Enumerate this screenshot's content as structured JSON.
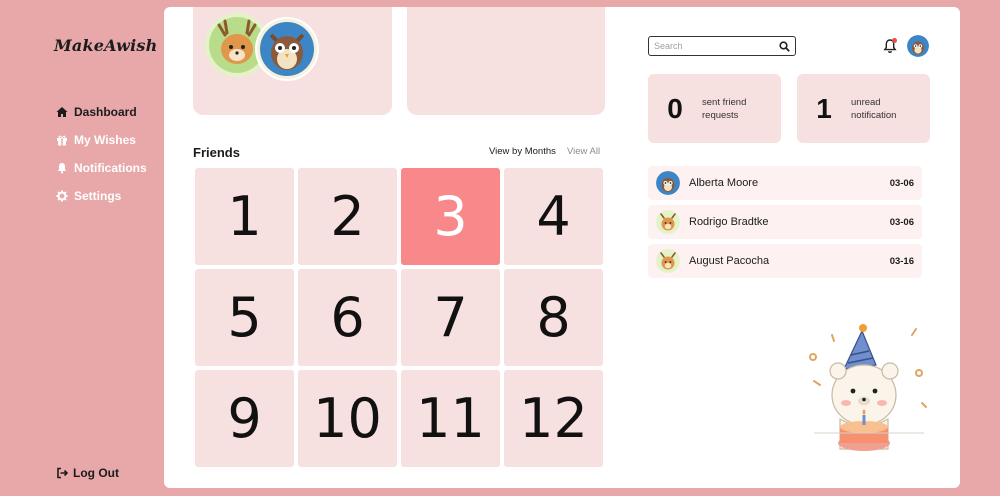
{
  "app": {
    "logo": "MakeAwish"
  },
  "sidebar": {
    "items": [
      {
        "label": "Dashboard",
        "icon": "home-icon",
        "active": true
      },
      {
        "label": "My Wishes",
        "icon": "gift-icon",
        "active": false
      },
      {
        "label": "Notifications",
        "icon": "bell-icon",
        "active": false
      },
      {
        "label": "Settings",
        "icon": "gear-icon",
        "active": false
      }
    ],
    "logout_label": "Log Out"
  },
  "friends": {
    "title": "Friends",
    "view_by_months": "View by Months",
    "view_all": "View All",
    "months": [
      "1",
      "2",
      "3",
      "4",
      "5",
      "6",
      "7",
      "8",
      "9",
      "10",
      "11",
      "12"
    ],
    "selected_month": "3"
  },
  "search": {
    "placeholder": "Search"
  },
  "stats": {
    "sent_requests_count": "0",
    "sent_requests_label": "sent friend requests",
    "unread_count": "1",
    "unread_label": "unread notification"
  },
  "requests": [
    {
      "name": "Alberta Moore",
      "date": "03-06",
      "avatar": "owl"
    },
    {
      "name": "Rodrigo Bradtke",
      "date": "03-06",
      "avatar": "deer"
    },
    {
      "name": "August Pacocha",
      "date": "03-16",
      "avatar": "deer"
    }
  ],
  "colors": {
    "accent": "#f8888a",
    "card": "#f7e0e0",
    "background": "#e8a7a9"
  }
}
